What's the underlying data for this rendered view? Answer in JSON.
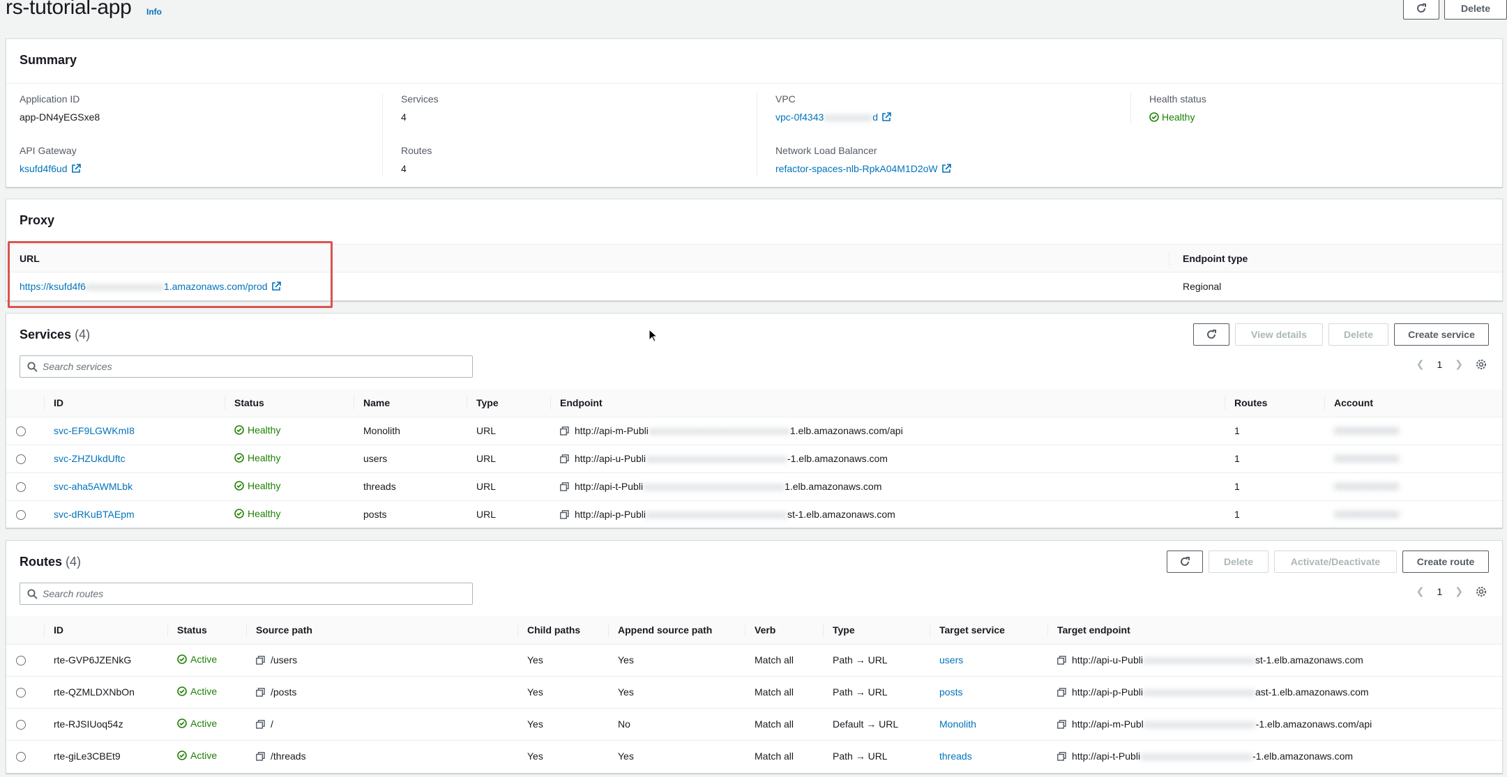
{
  "header": {
    "title": "rs-tutorial-app",
    "info": "Info",
    "delete_label": "Delete"
  },
  "summary": {
    "title": "Summary",
    "application_id_label": "Application ID",
    "application_id": "app-DN4yEGSxe8",
    "api_gateway_label": "API Gateway",
    "api_gateway": "ksufd4f6ud",
    "services_label": "Services",
    "services": "4",
    "routes_label": "Routes",
    "routes": "4",
    "vpc_label": "VPC",
    "vpc_prefix": "vpc-0f4343",
    "vpc_suffix": "d",
    "nlb_label": "Network Load Balancer",
    "nlb": "refactor-spaces-nlb-RpkA04M1D2oW",
    "health_label": "Health status",
    "health": "Healthy"
  },
  "proxy": {
    "title": "Proxy",
    "url_header": "URL",
    "endpoint_type_header": "Endpoint type",
    "url_prefix": "https://ksufd4f6",
    "url_suffix": "1.amazonaws.com/prod",
    "endpoint_type": "Regional"
  },
  "services": {
    "title": "Services",
    "count": "(4)",
    "view_details_label": "View details",
    "delete_label": "Delete",
    "create_label": "Create service",
    "search_placeholder": "Search services",
    "page": "1",
    "columns": [
      "ID",
      "Status",
      "Name",
      "Type",
      "Endpoint",
      "Routes",
      "Account"
    ],
    "rows": [
      {
        "id": "svc-EF9LGWKmI8",
        "status": "Healthy",
        "name": "Monolith",
        "type": "URL",
        "endpoint_prefix": "http://api-m-Publi",
        "endpoint_suffix": "1.elb.amazonaws.com/api",
        "routes": "1"
      },
      {
        "id": "svc-ZHZUkdUftc",
        "status": "Healthy",
        "name": "users",
        "type": "URL",
        "endpoint_prefix": "http://api-u-Publi",
        "endpoint_suffix": "-1.elb.amazonaws.com",
        "routes": "1"
      },
      {
        "id": "svc-aha5AWMLbk",
        "status": "Healthy",
        "name": "threads",
        "type": "URL",
        "endpoint_prefix": "http://api-t-Publi",
        "endpoint_suffix": "1.elb.amazonaws.com",
        "routes": "1"
      },
      {
        "id": "svc-dRKuBTAEpm",
        "status": "Healthy",
        "name": "posts",
        "type": "URL",
        "endpoint_prefix": "http://api-p-Publi",
        "endpoint_suffix": "st-1.elb.amazonaws.com",
        "routes": "1"
      }
    ]
  },
  "routes": {
    "title": "Routes",
    "count": "(4)",
    "delete_label": "Delete",
    "activate_label": "Activate/Deactivate",
    "create_label": "Create route",
    "search_placeholder": "Search routes",
    "page": "1",
    "columns": [
      "ID",
      "Status",
      "Source path",
      "Child paths",
      "Append source path",
      "Verb",
      "Type",
      "Target service",
      "Target endpoint"
    ],
    "rows": [
      {
        "id": "rte-GVP6JZENkG",
        "status": "Active",
        "source": "/users",
        "child": "Yes",
        "append": "Yes",
        "verb": "Match all",
        "type": "Path → URL",
        "target": "users",
        "endpoint_prefix": "http://api-u-Publi",
        "endpoint_suffix": "st-1.elb.amazonaws.com"
      },
      {
        "id": "rte-QZMLDXNbOn",
        "status": "Active",
        "source": "/posts",
        "child": "Yes",
        "append": "Yes",
        "verb": "Match all",
        "type": "Path → URL",
        "target": "posts",
        "endpoint_prefix": "http://api-p-Publi",
        "endpoint_suffix": "ast-1.elb.amazonaws.com"
      },
      {
        "id": "rte-RJSIUoq54z",
        "status": "Active",
        "source": "/",
        "child": "Yes",
        "append": "No",
        "verb": "Match all",
        "type": "Default → URL",
        "target": "Monolith",
        "endpoint_prefix": "http://api-m-Publ",
        "endpoint_suffix": "-1.elb.amazonaws.com/api"
      },
      {
        "id": "rte-giLe3CBEt9",
        "status": "Active",
        "source": "/threads",
        "child": "Yes",
        "append": "Yes",
        "verb": "Match all",
        "type": "Path → URL",
        "target": "threads",
        "endpoint_prefix": "http://api-t-Publi",
        "endpoint_suffix": "-1.elb.amazonaws.com"
      }
    ]
  }
}
